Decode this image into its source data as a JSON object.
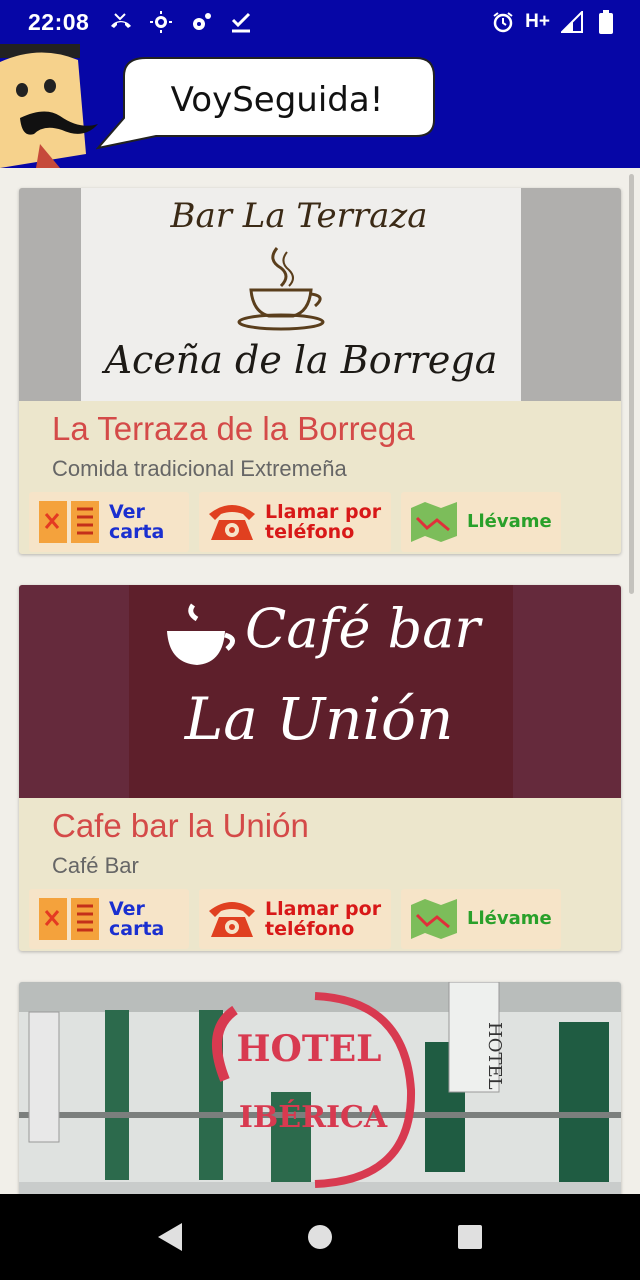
{
  "status_bar": {
    "time": "22:08",
    "network": "H+"
  },
  "header": {
    "app_title": "VoySeguida!"
  },
  "colors": {
    "app_bar": "#0606a6",
    "card_background": "#ece6cc",
    "title_red": "#d44a48",
    "action_background": "#f6e4c8"
  },
  "places": [
    {
      "title": "La Terraza de la Borrega",
      "subtitle": "Comida tradicional Extremeña",
      "image_text_line1": "Bar La Terraza",
      "image_text_line2": "Aceña de la Borrega",
      "actions": {
        "menu_line1": "Ver",
        "menu_line2": "carta",
        "call_line1": "Llamar por",
        "call_line2": "teléfono",
        "map": "Llévame"
      }
    },
    {
      "title": "Cafe bar la Unión",
      "subtitle": "Café Bar",
      "image_text_line1": "Café bar",
      "image_text_line2": "La Unión",
      "actions": {
        "menu_line1": "Ver",
        "menu_line2": "carta",
        "call_line1": "Llamar por",
        "call_line2": "teléfono",
        "map": "Llévame"
      }
    },
    {
      "image_text_line1": "HOTEL",
      "image_text_line2": "IBÉRICA",
      "image_sign": "HOTEL"
    }
  ]
}
